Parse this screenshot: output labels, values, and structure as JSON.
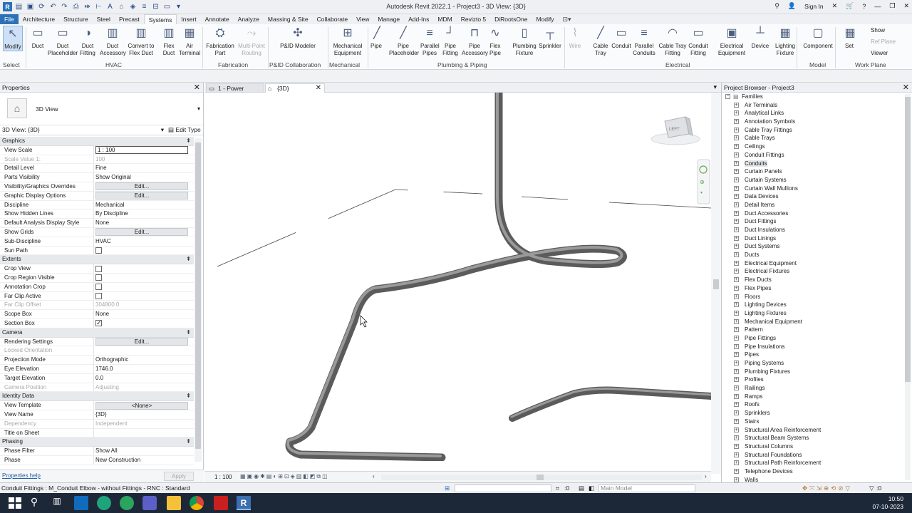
{
  "window": {
    "title": "Autodesk Revit 2022.1 - Project3 - 3D View: {3D}",
    "sign_in": "Sign In"
  },
  "tabs": [
    "File",
    "Architecture",
    "Structure",
    "Steel",
    "Precast",
    "Systems",
    "Insert",
    "Annotate",
    "Analyze",
    "Massing & Site",
    "Collaborate",
    "View",
    "Manage",
    "Add-Ins",
    "MDM",
    "Revizto 5",
    "DiRootsOne",
    "Modify"
  ],
  "active_tab": "Systems",
  "ribbon": {
    "buttons": [
      "Modify",
      "Duct",
      "Duct\nPlaceholder",
      "Duct\nFitting",
      "Duct\nAccessory",
      "Convert to\nFlex Duct",
      "Flex\nDuct",
      "Air\nTerminal",
      "Fabrication\nPart",
      "Multi-Point\nRouting",
      "P&ID Modeler",
      "Mechanical\nEquipment",
      "Pipe",
      "Pipe\nPlaceholder",
      "Parallel\nPipes",
      "Pipe\nFitting",
      "Pipe\nAccessory",
      "Flex\nPipe",
      "Plumbing\nFixture",
      "Sprinkler",
      "Wire",
      "Cable\nTray",
      "Conduit",
      "Parallel\nConduits",
      "Cable Tray\nFitting",
      "Conduit\nFitting",
      "Electrical\nEquipment",
      "Device",
      "Lighting\nFixture",
      "Component",
      "Set"
    ],
    "workplane_small": [
      "Show",
      "Ref Plane",
      "Viewer"
    ],
    "panels": [
      "Select",
      "HVAC",
      "Fabrication",
      "P&ID Collaboration",
      "Mechanical",
      "Plumbing & Piping",
      "Electrical",
      "Model",
      "Work Plane"
    ]
  },
  "properties": {
    "title": "Properties",
    "type_name": "3D View",
    "instance": "3D View: {3D}",
    "edit_type": "Edit Type",
    "groups": [
      {
        "name": "Graphics",
        "rows": [
          [
            "View Scale",
            "1 : 100",
            "input"
          ],
          [
            "Scale Value    1:",
            "100",
            "dim"
          ],
          [
            "Detail Level",
            "Fine",
            ""
          ],
          [
            "Parts Visibility",
            "Show Original",
            ""
          ],
          [
            "Visibility/Graphics Overrides",
            "Edit...",
            "button"
          ],
          [
            "Graphic Display Options",
            "Edit...",
            "button"
          ],
          [
            "Discipline",
            "Mechanical",
            ""
          ],
          [
            "Show Hidden Lines",
            "By Discipline",
            ""
          ],
          [
            "Default Analysis Display Style",
            "None",
            ""
          ],
          [
            "Show Grids",
            "Edit...",
            "button"
          ],
          [
            "Sub-Discipline",
            "HVAC",
            ""
          ],
          [
            "Sun Path",
            "",
            "check-off"
          ]
        ]
      },
      {
        "name": "Extents",
        "rows": [
          [
            "Crop View",
            "",
            "check-off"
          ],
          [
            "Crop Region Visible",
            "",
            "check-off"
          ],
          [
            "Annotation Crop",
            "",
            "check-off"
          ],
          [
            "Far Clip Active",
            "",
            "check-off"
          ],
          [
            "Far Clip Offset",
            "304800.0",
            "dim"
          ],
          [
            "Scope Box",
            "None",
            ""
          ],
          [
            "Section Box",
            "",
            "check-on"
          ]
        ]
      },
      {
        "name": "Camera",
        "rows": [
          [
            "Rendering Settings",
            "Edit...",
            "button"
          ],
          [
            "Locked Orientation",
            "",
            "dim"
          ],
          [
            "Projection Mode",
            "Orthographic",
            ""
          ],
          [
            "Eye Elevation",
            "1746.0",
            ""
          ],
          [
            "Target Elevation",
            "0.0",
            ""
          ],
          [
            "Camera Position",
            "Adjusting",
            "dim"
          ]
        ]
      },
      {
        "name": "Identity Data",
        "rows": [
          [
            "View Template",
            "<None>",
            "button"
          ],
          [
            "View Name",
            "{3D}",
            ""
          ],
          [
            "Dependency",
            "Independent",
            "dim"
          ],
          [
            "Title on Sheet",
            "",
            ""
          ]
        ]
      },
      {
        "name": "Phasing",
        "rows": [
          [
            "Phase Filter",
            "Show All",
            ""
          ],
          [
            "Phase",
            "New Construction",
            ""
          ]
        ]
      }
    ],
    "help": "Properties help",
    "apply": "Apply"
  },
  "view_tabs": [
    "1 - Power",
    "{3D}"
  ],
  "view_scale": "1 : 100",
  "viewcube_face": "LEFT",
  "browser": {
    "title": "Project Browser - Project3",
    "root": "Families",
    "items": [
      "Air Terminals",
      "Analytical Links",
      "Annotation Symbols",
      "Cable Tray Fittings",
      "Cable Trays",
      "Ceilings",
      "Conduit Fittings",
      "Conduits",
      "Curtain Panels",
      "Curtain Systems",
      "Curtain Wall Mullions",
      "Data Devices",
      "Detail Items",
      "Duct Accessories",
      "Duct Fittings",
      "Duct Insulations",
      "Duct Linings",
      "Duct Systems",
      "Ducts",
      "Electrical Equipment",
      "Electrical Fixtures",
      "Flex Ducts",
      "Flex Pipes",
      "Floors",
      "Lighting Devices",
      "Lighting Fixtures",
      "Mechanical Equipment",
      "Pattern",
      "Pipe Fittings",
      "Pipe Insulations",
      "Pipes",
      "Piping Systems",
      "Plumbing Fixtures",
      "Profiles",
      "Railings",
      "Ramps",
      "Roofs",
      "Sprinklers",
      "Stairs",
      "Structural Area Reinforcement",
      "Structural Beam Systems",
      "Structural Columns",
      "Structural Foundations",
      "Structural Path Reinforcement",
      "Telephone Devices",
      "Walls"
    ],
    "selected": "Conduits"
  },
  "status": {
    "text": "Conduit Fittings : M_Conduit Elbow - without Fittings - RNC : Standard",
    "zero": ":0",
    "model": "Main Model",
    "filter_count": ":0"
  },
  "clock": {
    "time": "10:50",
    "date": "07-10-2023"
  }
}
